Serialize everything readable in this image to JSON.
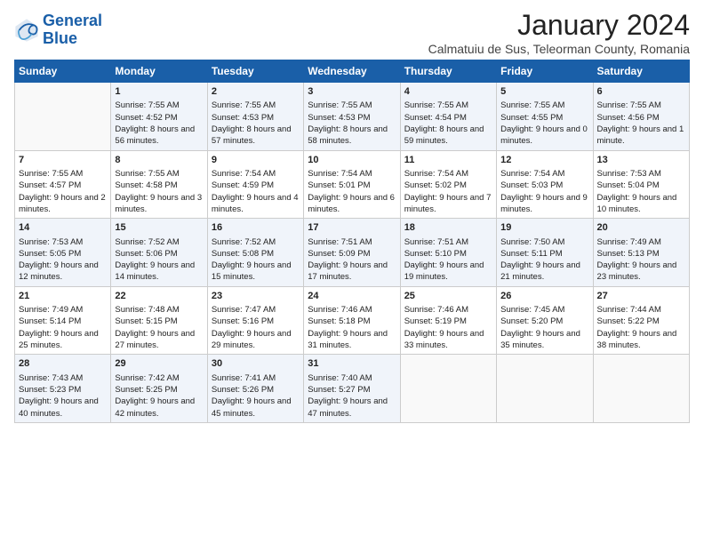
{
  "logo": {
    "line1": "General",
    "line2": "Blue"
  },
  "title": "January 2024",
  "location": "Calmatuiu de Sus, Teleorman County, Romania",
  "headers": [
    "Sunday",
    "Monday",
    "Tuesday",
    "Wednesday",
    "Thursday",
    "Friday",
    "Saturday"
  ],
  "rows": [
    [
      {
        "day": "",
        "sunrise": "",
        "sunset": "",
        "daylight": ""
      },
      {
        "day": "1",
        "sunrise": "Sunrise: 7:55 AM",
        "sunset": "Sunset: 4:52 PM",
        "daylight": "Daylight: 8 hours and 56 minutes."
      },
      {
        "day": "2",
        "sunrise": "Sunrise: 7:55 AM",
        "sunset": "Sunset: 4:53 PM",
        "daylight": "Daylight: 8 hours and 57 minutes."
      },
      {
        "day": "3",
        "sunrise": "Sunrise: 7:55 AM",
        "sunset": "Sunset: 4:53 PM",
        "daylight": "Daylight: 8 hours and 58 minutes."
      },
      {
        "day": "4",
        "sunrise": "Sunrise: 7:55 AM",
        "sunset": "Sunset: 4:54 PM",
        "daylight": "Daylight: 8 hours and 59 minutes."
      },
      {
        "day": "5",
        "sunrise": "Sunrise: 7:55 AM",
        "sunset": "Sunset: 4:55 PM",
        "daylight": "Daylight: 9 hours and 0 minutes."
      },
      {
        "day": "6",
        "sunrise": "Sunrise: 7:55 AM",
        "sunset": "Sunset: 4:56 PM",
        "daylight": "Daylight: 9 hours and 1 minute."
      }
    ],
    [
      {
        "day": "7",
        "sunrise": "Sunrise: 7:55 AM",
        "sunset": "Sunset: 4:57 PM",
        "daylight": "Daylight: 9 hours and 2 minutes."
      },
      {
        "day": "8",
        "sunrise": "Sunrise: 7:55 AM",
        "sunset": "Sunset: 4:58 PM",
        "daylight": "Daylight: 9 hours and 3 minutes."
      },
      {
        "day": "9",
        "sunrise": "Sunrise: 7:54 AM",
        "sunset": "Sunset: 4:59 PM",
        "daylight": "Daylight: 9 hours and 4 minutes."
      },
      {
        "day": "10",
        "sunrise": "Sunrise: 7:54 AM",
        "sunset": "Sunset: 5:01 PM",
        "daylight": "Daylight: 9 hours and 6 minutes."
      },
      {
        "day": "11",
        "sunrise": "Sunrise: 7:54 AM",
        "sunset": "Sunset: 5:02 PM",
        "daylight": "Daylight: 9 hours and 7 minutes."
      },
      {
        "day": "12",
        "sunrise": "Sunrise: 7:54 AM",
        "sunset": "Sunset: 5:03 PM",
        "daylight": "Daylight: 9 hours and 9 minutes."
      },
      {
        "day": "13",
        "sunrise": "Sunrise: 7:53 AM",
        "sunset": "Sunset: 5:04 PM",
        "daylight": "Daylight: 9 hours and 10 minutes."
      }
    ],
    [
      {
        "day": "14",
        "sunrise": "Sunrise: 7:53 AM",
        "sunset": "Sunset: 5:05 PM",
        "daylight": "Daylight: 9 hours and 12 minutes."
      },
      {
        "day": "15",
        "sunrise": "Sunrise: 7:52 AM",
        "sunset": "Sunset: 5:06 PM",
        "daylight": "Daylight: 9 hours and 14 minutes."
      },
      {
        "day": "16",
        "sunrise": "Sunrise: 7:52 AM",
        "sunset": "Sunset: 5:08 PM",
        "daylight": "Daylight: 9 hours and 15 minutes."
      },
      {
        "day": "17",
        "sunrise": "Sunrise: 7:51 AM",
        "sunset": "Sunset: 5:09 PM",
        "daylight": "Daylight: 9 hours and 17 minutes."
      },
      {
        "day": "18",
        "sunrise": "Sunrise: 7:51 AM",
        "sunset": "Sunset: 5:10 PM",
        "daylight": "Daylight: 9 hours and 19 minutes."
      },
      {
        "day": "19",
        "sunrise": "Sunrise: 7:50 AM",
        "sunset": "Sunset: 5:11 PM",
        "daylight": "Daylight: 9 hours and 21 minutes."
      },
      {
        "day": "20",
        "sunrise": "Sunrise: 7:49 AM",
        "sunset": "Sunset: 5:13 PM",
        "daylight": "Daylight: 9 hours and 23 minutes."
      }
    ],
    [
      {
        "day": "21",
        "sunrise": "Sunrise: 7:49 AM",
        "sunset": "Sunset: 5:14 PM",
        "daylight": "Daylight: 9 hours and 25 minutes."
      },
      {
        "day": "22",
        "sunrise": "Sunrise: 7:48 AM",
        "sunset": "Sunset: 5:15 PM",
        "daylight": "Daylight: 9 hours and 27 minutes."
      },
      {
        "day": "23",
        "sunrise": "Sunrise: 7:47 AM",
        "sunset": "Sunset: 5:16 PM",
        "daylight": "Daylight: 9 hours and 29 minutes."
      },
      {
        "day": "24",
        "sunrise": "Sunrise: 7:46 AM",
        "sunset": "Sunset: 5:18 PM",
        "daylight": "Daylight: 9 hours and 31 minutes."
      },
      {
        "day": "25",
        "sunrise": "Sunrise: 7:46 AM",
        "sunset": "Sunset: 5:19 PM",
        "daylight": "Daylight: 9 hours and 33 minutes."
      },
      {
        "day": "26",
        "sunrise": "Sunrise: 7:45 AM",
        "sunset": "Sunset: 5:20 PM",
        "daylight": "Daylight: 9 hours and 35 minutes."
      },
      {
        "day": "27",
        "sunrise": "Sunrise: 7:44 AM",
        "sunset": "Sunset: 5:22 PM",
        "daylight": "Daylight: 9 hours and 38 minutes."
      }
    ],
    [
      {
        "day": "28",
        "sunrise": "Sunrise: 7:43 AM",
        "sunset": "Sunset: 5:23 PM",
        "daylight": "Daylight: 9 hours and 40 minutes."
      },
      {
        "day": "29",
        "sunrise": "Sunrise: 7:42 AM",
        "sunset": "Sunset: 5:25 PM",
        "daylight": "Daylight: 9 hours and 42 minutes."
      },
      {
        "day": "30",
        "sunrise": "Sunrise: 7:41 AM",
        "sunset": "Sunset: 5:26 PM",
        "daylight": "Daylight: 9 hours and 45 minutes."
      },
      {
        "day": "31",
        "sunrise": "Sunrise: 7:40 AM",
        "sunset": "Sunset: 5:27 PM",
        "daylight": "Daylight: 9 hours and 47 minutes."
      },
      {
        "day": "",
        "sunrise": "",
        "sunset": "",
        "daylight": ""
      },
      {
        "day": "",
        "sunrise": "",
        "sunset": "",
        "daylight": ""
      },
      {
        "day": "",
        "sunrise": "",
        "sunset": "",
        "daylight": ""
      }
    ]
  ]
}
